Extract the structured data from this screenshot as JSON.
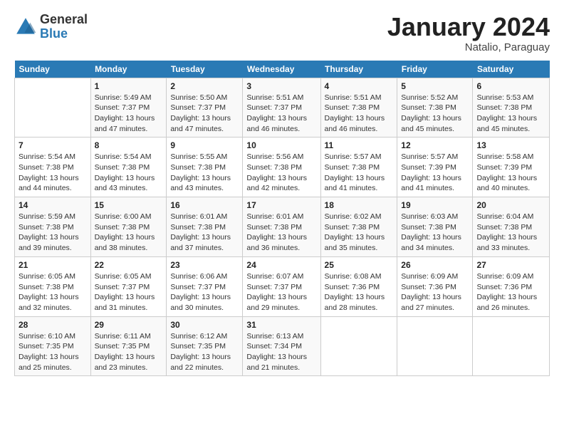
{
  "logo": {
    "general": "General",
    "blue": "Blue"
  },
  "header": {
    "month": "January 2024",
    "location": "Natalio, Paraguay"
  },
  "weekdays": [
    "Sunday",
    "Monday",
    "Tuesday",
    "Wednesday",
    "Thursday",
    "Friday",
    "Saturday"
  ],
  "weeks": [
    [
      {
        "day": "",
        "sunrise": "",
        "sunset": "",
        "daylight": ""
      },
      {
        "day": "1",
        "sunrise": "Sunrise: 5:49 AM",
        "sunset": "Sunset: 7:37 PM",
        "daylight": "Daylight: 13 hours and 47 minutes."
      },
      {
        "day": "2",
        "sunrise": "Sunrise: 5:50 AM",
        "sunset": "Sunset: 7:37 PM",
        "daylight": "Daylight: 13 hours and 47 minutes."
      },
      {
        "day": "3",
        "sunrise": "Sunrise: 5:51 AM",
        "sunset": "Sunset: 7:37 PM",
        "daylight": "Daylight: 13 hours and 46 minutes."
      },
      {
        "day": "4",
        "sunrise": "Sunrise: 5:51 AM",
        "sunset": "Sunset: 7:38 PM",
        "daylight": "Daylight: 13 hours and 46 minutes."
      },
      {
        "day": "5",
        "sunrise": "Sunrise: 5:52 AM",
        "sunset": "Sunset: 7:38 PM",
        "daylight": "Daylight: 13 hours and 45 minutes."
      },
      {
        "day": "6",
        "sunrise": "Sunrise: 5:53 AM",
        "sunset": "Sunset: 7:38 PM",
        "daylight": "Daylight: 13 hours and 45 minutes."
      }
    ],
    [
      {
        "day": "7",
        "sunrise": "Sunrise: 5:54 AM",
        "sunset": "Sunset: 7:38 PM",
        "daylight": "Daylight: 13 hours and 44 minutes."
      },
      {
        "day": "8",
        "sunrise": "Sunrise: 5:54 AM",
        "sunset": "Sunset: 7:38 PM",
        "daylight": "Daylight: 13 hours and 43 minutes."
      },
      {
        "day": "9",
        "sunrise": "Sunrise: 5:55 AM",
        "sunset": "Sunset: 7:38 PM",
        "daylight": "Daylight: 13 hours and 43 minutes."
      },
      {
        "day": "10",
        "sunrise": "Sunrise: 5:56 AM",
        "sunset": "Sunset: 7:38 PM",
        "daylight": "Daylight: 13 hours and 42 minutes."
      },
      {
        "day": "11",
        "sunrise": "Sunrise: 5:57 AM",
        "sunset": "Sunset: 7:38 PM",
        "daylight": "Daylight: 13 hours and 41 minutes."
      },
      {
        "day": "12",
        "sunrise": "Sunrise: 5:57 AM",
        "sunset": "Sunset: 7:39 PM",
        "daylight": "Daylight: 13 hours and 41 minutes."
      },
      {
        "day": "13",
        "sunrise": "Sunrise: 5:58 AM",
        "sunset": "Sunset: 7:39 PM",
        "daylight": "Daylight: 13 hours and 40 minutes."
      }
    ],
    [
      {
        "day": "14",
        "sunrise": "Sunrise: 5:59 AM",
        "sunset": "Sunset: 7:38 PM",
        "daylight": "Daylight: 13 hours and 39 minutes."
      },
      {
        "day": "15",
        "sunrise": "Sunrise: 6:00 AM",
        "sunset": "Sunset: 7:38 PM",
        "daylight": "Daylight: 13 hours and 38 minutes."
      },
      {
        "day": "16",
        "sunrise": "Sunrise: 6:01 AM",
        "sunset": "Sunset: 7:38 PM",
        "daylight": "Daylight: 13 hours and 37 minutes."
      },
      {
        "day": "17",
        "sunrise": "Sunrise: 6:01 AM",
        "sunset": "Sunset: 7:38 PM",
        "daylight": "Daylight: 13 hours and 36 minutes."
      },
      {
        "day": "18",
        "sunrise": "Sunrise: 6:02 AM",
        "sunset": "Sunset: 7:38 PM",
        "daylight": "Daylight: 13 hours and 35 minutes."
      },
      {
        "day": "19",
        "sunrise": "Sunrise: 6:03 AM",
        "sunset": "Sunset: 7:38 PM",
        "daylight": "Daylight: 13 hours and 34 minutes."
      },
      {
        "day": "20",
        "sunrise": "Sunrise: 6:04 AM",
        "sunset": "Sunset: 7:38 PM",
        "daylight": "Daylight: 13 hours and 33 minutes."
      }
    ],
    [
      {
        "day": "21",
        "sunrise": "Sunrise: 6:05 AM",
        "sunset": "Sunset: 7:38 PM",
        "daylight": "Daylight: 13 hours and 32 minutes."
      },
      {
        "day": "22",
        "sunrise": "Sunrise: 6:05 AM",
        "sunset": "Sunset: 7:37 PM",
        "daylight": "Daylight: 13 hours and 31 minutes."
      },
      {
        "day": "23",
        "sunrise": "Sunrise: 6:06 AM",
        "sunset": "Sunset: 7:37 PM",
        "daylight": "Daylight: 13 hours and 30 minutes."
      },
      {
        "day": "24",
        "sunrise": "Sunrise: 6:07 AM",
        "sunset": "Sunset: 7:37 PM",
        "daylight": "Daylight: 13 hours and 29 minutes."
      },
      {
        "day": "25",
        "sunrise": "Sunrise: 6:08 AM",
        "sunset": "Sunset: 7:36 PM",
        "daylight": "Daylight: 13 hours and 28 minutes."
      },
      {
        "day": "26",
        "sunrise": "Sunrise: 6:09 AM",
        "sunset": "Sunset: 7:36 PM",
        "daylight": "Daylight: 13 hours and 27 minutes."
      },
      {
        "day": "27",
        "sunrise": "Sunrise: 6:09 AM",
        "sunset": "Sunset: 7:36 PM",
        "daylight": "Daylight: 13 hours and 26 minutes."
      }
    ],
    [
      {
        "day": "28",
        "sunrise": "Sunrise: 6:10 AM",
        "sunset": "Sunset: 7:35 PM",
        "daylight": "Daylight: 13 hours and 25 minutes."
      },
      {
        "day": "29",
        "sunrise": "Sunrise: 6:11 AM",
        "sunset": "Sunset: 7:35 PM",
        "daylight": "Daylight: 13 hours and 23 minutes."
      },
      {
        "day": "30",
        "sunrise": "Sunrise: 6:12 AM",
        "sunset": "Sunset: 7:35 PM",
        "daylight": "Daylight: 13 hours and 22 minutes."
      },
      {
        "day": "31",
        "sunrise": "Sunrise: 6:13 AM",
        "sunset": "Sunset: 7:34 PM",
        "daylight": "Daylight: 13 hours and 21 minutes."
      },
      {
        "day": "",
        "sunrise": "",
        "sunset": "",
        "daylight": ""
      },
      {
        "day": "",
        "sunrise": "",
        "sunset": "",
        "daylight": ""
      },
      {
        "day": "",
        "sunrise": "",
        "sunset": "",
        "daylight": ""
      }
    ]
  ]
}
